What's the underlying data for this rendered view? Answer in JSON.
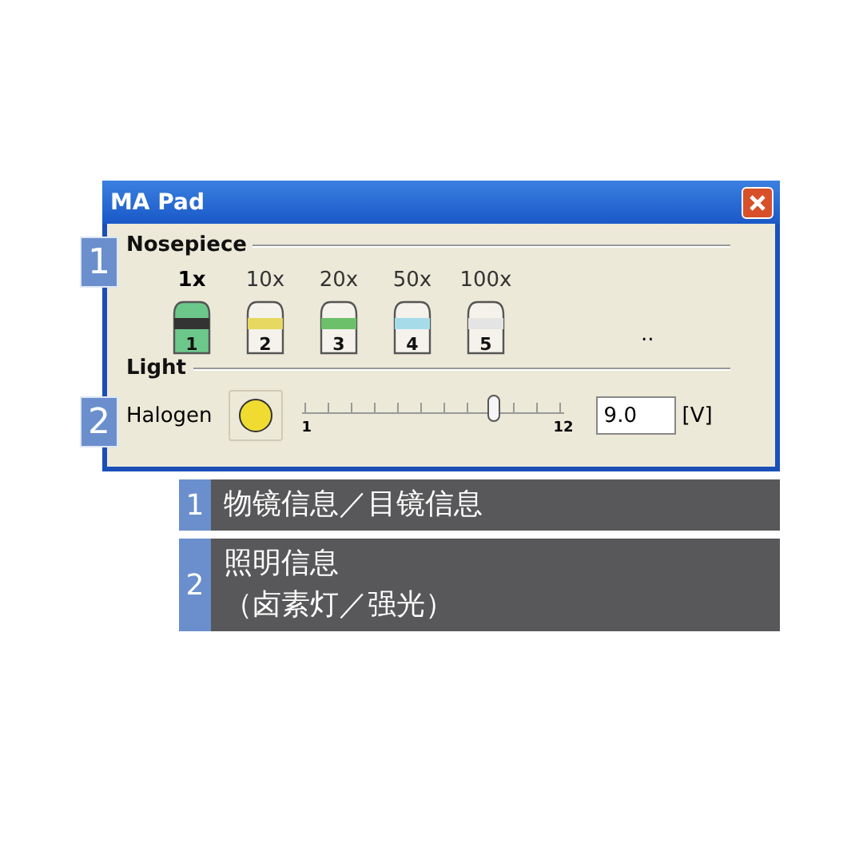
{
  "window": {
    "title": "MA Pad"
  },
  "callouts": [
    {
      "number": "1"
    },
    {
      "number": "2"
    }
  ],
  "nosepiece": {
    "title": "Nosepiece",
    "objectives": [
      {
        "label": "1x",
        "number": "1",
        "color": "#333333",
        "selected": true
      },
      {
        "label": "10x",
        "number": "2",
        "color": "#e6d860",
        "selected": false
      },
      {
        "label": "20x",
        "number": "3",
        "color": "#6cc06a",
        "selected": false
      },
      {
        "label": "50x",
        "number": "4",
        "color": "#a6dcea",
        "selected": false
      },
      {
        "label": "100x",
        "number": "5",
        "color": "#e4e4e4",
        "selected": false
      }
    ],
    "more": ".."
  },
  "light": {
    "title": "Light",
    "source": "Halogen",
    "lamp_on": true,
    "slider_min": "1",
    "slider_max": "12",
    "level": 0.727,
    "value": "9.0",
    "unit": "[V]"
  },
  "legend": [
    {
      "number": "1",
      "lines": [
        "物镜信息／目镜信息"
      ]
    },
    {
      "number": "2",
      "lines": [
        "照明信息",
        "（卤素灯／强光）"
      ]
    }
  ]
}
